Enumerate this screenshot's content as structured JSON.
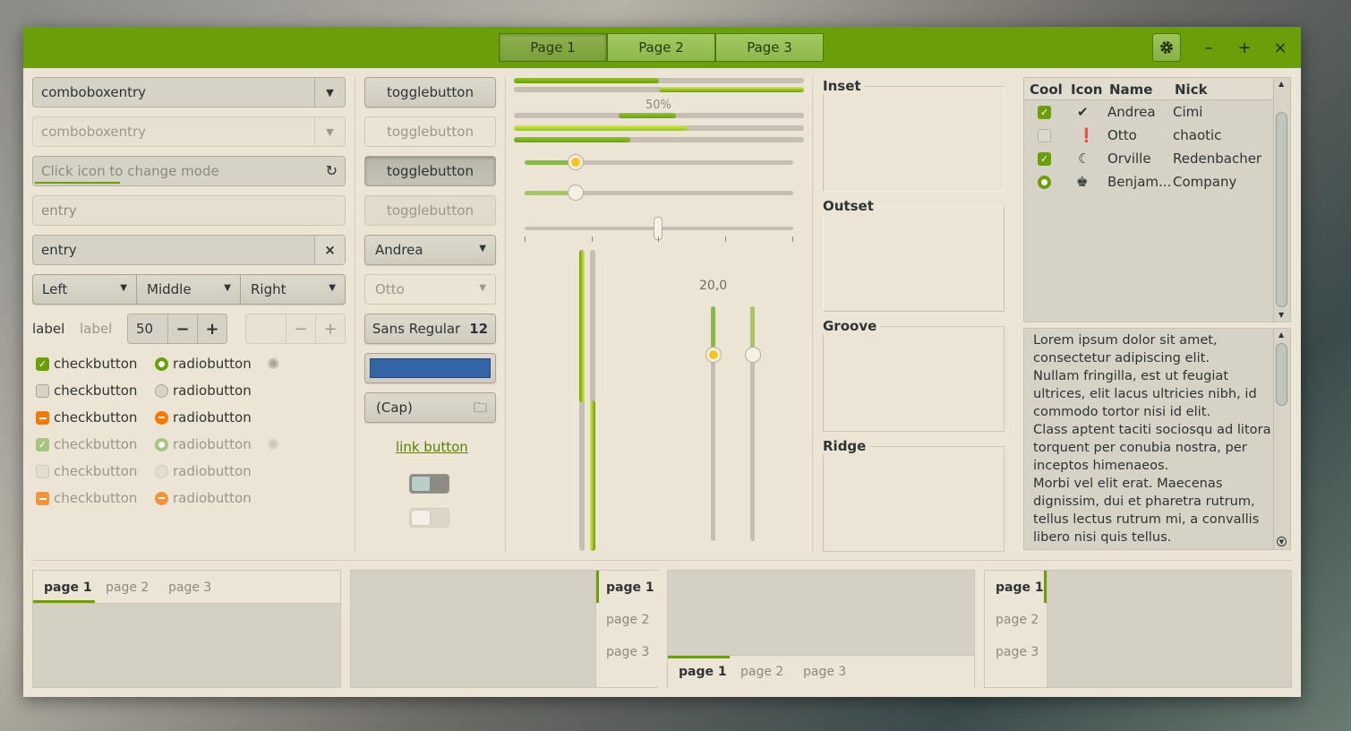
{
  "header": {
    "switcher": [
      "Page 1",
      "Page 2",
      "Page 3"
    ],
    "gear_icon": "gear-icon",
    "minimize": "–",
    "maximize": "+",
    "close": "×"
  },
  "col1": {
    "combo1": "comboboxentry",
    "combo2": "comboboxentry",
    "mode_entry_placeholder": "Click icon to change mode",
    "entry_flat": "entry",
    "entry_clear": "entry",
    "linked": [
      "Left",
      "Middle",
      "Right"
    ],
    "label1": "label",
    "label2": "label",
    "spin_value": "50",
    "spin_minus": "−",
    "spin_plus": "+",
    "checks": [
      "checkbutton",
      "checkbutton",
      "checkbutton",
      "checkbutton",
      "checkbutton",
      "checkbutton"
    ],
    "radios": [
      "radiobutton",
      "radiobutton",
      "radiobutton",
      "radiobutton",
      "radiobutton",
      "radiobutton"
    ]
  },
  "col2": {
    "toggles": [
      "togglebutton",
      "togglebutton",
      "togglebutton",
      "togglebutton"
    ],
    "combo_andrea": "Andrea",
    "combo_otto": "Otto",
    "font_name": "Sans Regular",
    "font_size": "12",
    "color_value": "#3465a4",
    "file_label": "(Cap)",
    "link": "link button"
  },
  "col3": {
    "progress_label": "50%",
    "progress_values": [
      0.5,
      0.5,
      0.25,
      0.6,
      0.4
    ],
    "scale_value_label": "20,0"
  },
  "frames": [
    "Inset",
    "Outset",
    "Groove",
    "Ridge"
  ],
  "tree": {
    "headers": [
      "Cool",
      "Icon",
      "Name",
      "Nick"
    ],
    "rows": [
      {
        "name": "Andrea",
        "nick": "Cimi",
        "icon": "check-circle-icon"
      },
      {
        "name": "Otto",
        "nick": "chaotic",
        "icon": "exclamation-icon"
      },
      {
        "name": "Orville",
        "nick": "Redenbacher",
        "icon": "moon-icon"
      },
      {
        "name": "Benjam...",
        "nick": "Company",
        "icon": "stamp-icon"
      }
    ]
  },
  "text_view": [
    "Lorem ipsum dolor sit amet,",
    "consectetur adipiscing elit.",
    "Nullam fringilla, est ut feugiat",
    "ultrices, elit lacus ultricies nibh, id",
    "commodo tortor nisi id elit.",
    "Class aptent taciti sociosqu ad litora",
    "torquent per conubia nostra, per",
    "inceptos himenaeos.",
    "Morbi vel elit erat. Maecenas",
    "dignissim, dui et pharetra rutrum,",
    "tellus lectus rutrum mi, a convallis",
    "libero nisi quis tellus."
  ],
  "notebooks": {
    "tabs": [
      "page 1",
      "page 2",
      "page 3"
    ]
  },
  "colors": {
    "accent": "#6a9f0a",
    "bg": "#ece4d4",
    "warning": "#f57900"
  }
}
